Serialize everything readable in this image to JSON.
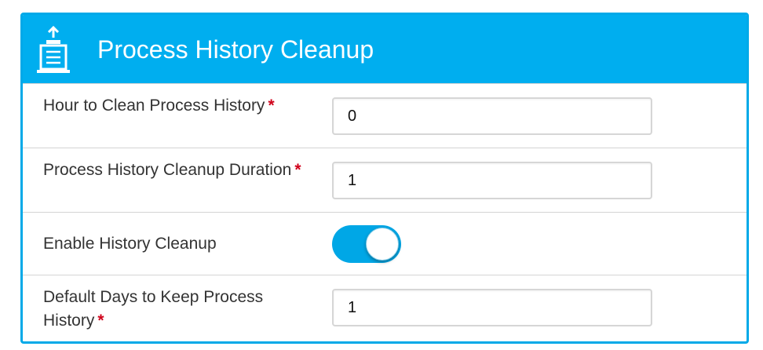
{
  "panel": {
    "title": "Process History Cleanup",
    "icon": "upload-archive-icon",
    "accent_color": "#00aeef"
  },
  "fields": {
    "hour_to_clean": {
      "label": "Hour to Clean Process History",
      "required_mark": "*",
      "value": "0"
    },
    "cleanup_duration": {
      "label": "Process History Cleanup Duration",
      "required_mark": "*",
      "value": "1"
    },
    "enable_cleanup": {
      "label": "Enable History Cleanup",
      "enabled": true
    },
    "default_days": {
      "label": "Default Days to Keep Process History",
      "required_mark": "*",
      "value": "1"
    }
  }
}
